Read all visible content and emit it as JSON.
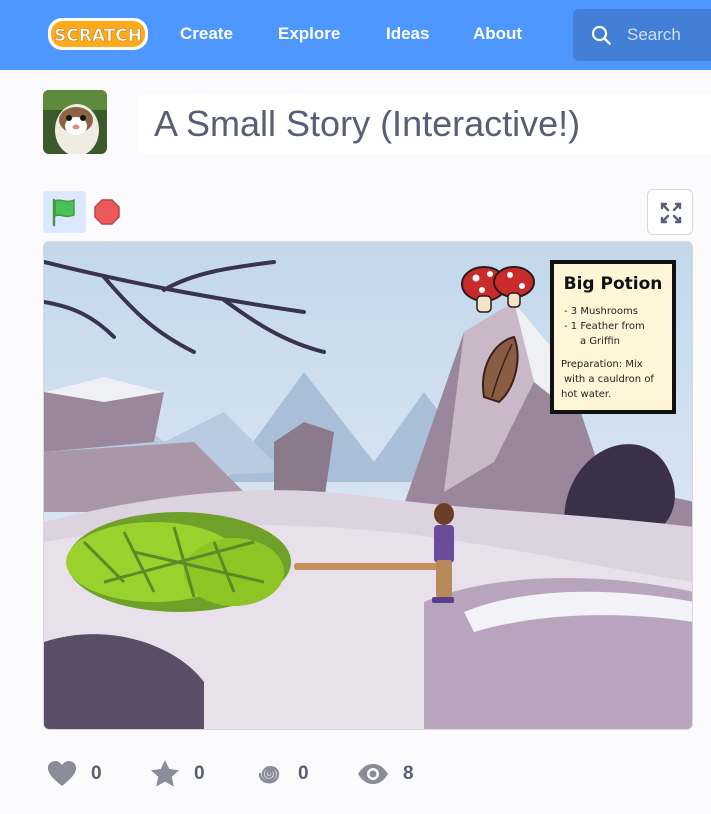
{
  "nav": {
    "logo_text": "SCRATCH",
    "items": [
      "Create",
      "Explore",
      "Ideas",
      "About"
    ],
    "search_placeholder": "Search"
  },
  "project": {
    "title": "A Small Story (Interactive!)"
  },
  "stage": {
    "recipe_title": "Big Potion",
    "recipe_items": [
      "- 3 Mushrooms",
      "- 1 Feather from",
      "a Griffin"
    ],
    "preparation": [
      "Preparation: Mix",
      "with a cauldron of",
      "hot water."
    ]
  },
  "stats": {
    "loves": "0",
    "favorites": "0",
    "remixes": "0",
    "views": "8"
  },
  "colors": {
    "brand": "#4d97ff",
    "search_bg": "#4280d7",
    "text": "#575e75"
  }
}
